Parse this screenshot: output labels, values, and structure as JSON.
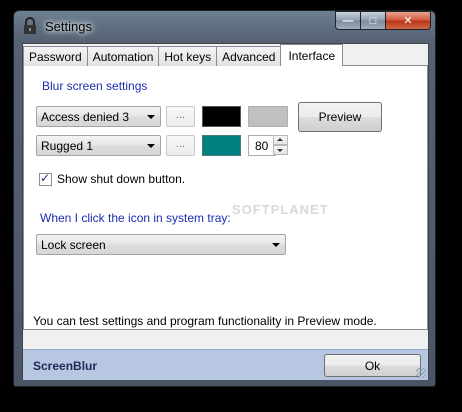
{
  "window": {
    "title": "Settings",
    "caption_buttons": {
      "minimize": "—",
      "maximize": "□",
      "close": "✕"
    }
  },
  "tabs": [
    {
      "label": "Password",
      "active": false
    },
    {
      "label": "Automation",
      "active": false
    },
    {
      "label": "Hot keys",
      "active": false
    },
    {
      "label": "Advanced",
      "active": false
    },
    {
      "label": "Interface",
      "active": true
    }
  ],
  "interface": {
    "blur_section_label": "Blur screen settings",
    "theme_combo": {
      "value": "Access denied 3"
    },
    "style_combo": {
      "value": "Rugged 1"
    },
    "browse_label": "...",
    "color1": "#000000",
    "color2": "#c0c0c0",
    "color3": "#008080",
    "opacity_value": "80",
    "preview_button": "Preview",
    "show_shutdown": {
      "label": "Show shut down button.",
      "checked": true
    },
    "tray_label": "When I click the icon in system tray:",
    "tray_combo": {
      "value": "Lock screen"
    },
    "hint_text": "You can test settings and program functionality in Preview mode."
  },
  "footer": {
    "brand": "ScreenBlur",
    "ok_button": "Ok"
  },
  "watermark": "SOFTPLANET",
  "colors": {
    "accent_label": "#1a2fb0",
    "footer_bg": "#b7c7e2",
    "brand_text": "#1d2c55"
  }
}
